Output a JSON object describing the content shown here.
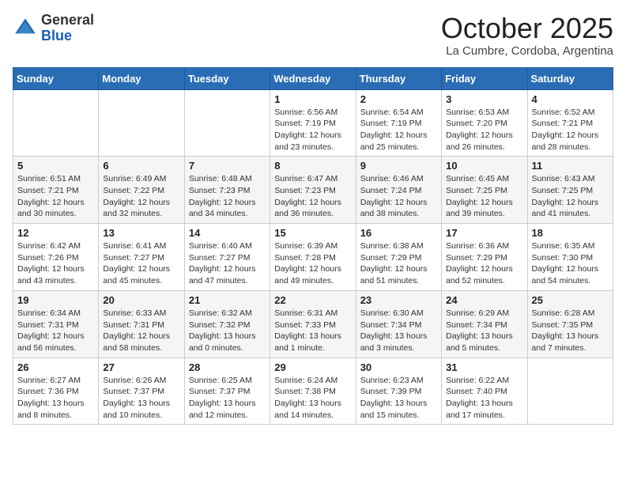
{
  "header": {
    "logo_general": "General",
    "logo_blue": "Blue",
    "month": "October 2025",
    "location": "La Cumbre, Cordoba, Argentina"
  },
  "days_of_week": [
    "Sunday",
    "Monday",
    "Tuesday",
    "Wednesday",
    "Thursday",
    "Friday",
    "Saturday"
  ],
  "weeks": [
    [
      {
        "date": "",
        "sunrise": "",
        "sunset": "",
        "daylight": ""
      },
      {
        "date": "",
        "sunrise": "",
        "sunset": "",
        "daylight": ""
      },
      {
        "date": "",
        "sunrise": "",
        "sunset": "",
        "daylight": ""
      },
      {
        "date": "1",
        "sunrise": "Sunrise: 6:56 AM",
        "sunset": "Sunset: 7:19 PM",
        "daylight": "Daylight: 12 hours and 23 minutes."
      },
      {
        "date": "2",
        "sunrise": "Sunrise: 6:54 AM",
        "sunset": "Sunset: 7:19 PM",
        "daylight": "Daylight: 12 hours and 25 minutes."
      },
      {
        "date": "3",
        "sunrise": "Sunrise: 6:53 AM",
        "sunset": "Sunset: 7:20 PM",
        "daylight": "Daylight: 12 hours and 26 minutes."
      },
      {
        "date": "4",
        "sunrise": "Sunrise: 6:52 AM",
        "sunset": "Sunset: 7:21 PM",
        "daylight": "Daylight: 12 hours and 28 minutes."
      }
    ],
    [
      {
        "date": "5",
        "sunrise": "Sunrise: 6:51 AM",
        "sunset": "Sunset: 7:21 PM",
        "daylight": "Daylight: 12 hours and 30 minutes."
      },
      {
        "date": "6",
        "sunrise": "Sunrise: 6:49 AM",
        "sunset": "Sunset: 7:22 PM",
        "daylight": "Daylight: 12 hours and 32 minutes."
      },
      {
        "date": "7",
        "sunrise": "Sunrise: 6:48 AM",
        "sunset": "Sunset: 7:23 PM",
        "daylight": "Daylight: 12 hours and 34 minutes."
      },
      {
        "date": "8",
        "sunrise": "Sunrise: 6:47 AM",
        "sunset": "Sunset: 7:23 PM",
        "daylight": "Daylight: 12 hours and 36 minutes."
      },
      {
        "date": "9",
        "sunrise": "Sunrise: 6:46 AM",
        "sunset": "Sunset: 7:24 PM",
        "daylight": "Daylight: 12 hours and 38 minutes."
      },
      {
        "date": "10",
        "sunrise": "Sunrise: 6:45 AM",
        "sunset": "Sunset: 7:25 PM",
        "daylight": "Daylight: 12 hours and 39 minutes."
      },
      {
        "date": "11",
        "sunrise": "Sunrise: 6:43 AM",
        "sunset": "Sunset: 7:25 PM",
        "daylight": "Daylight: 12 hours and 41 minutes."
      }
    ],
    [
      {
        "date": "12",
        "sunrise": "Sunrise: 6:42 AM",
        "sunset": "Sunset: 7:26 PM",
        "daylight": "Daylight: 12 hours and 43 minutes."
      },
      {
        "date": "13",
        "sunrise": "Sunrise: 6:41 AM",
        "sunset": "Sunset: 7:27 PM",
        "daylight": "Daylight: 12 hours and 45 minutes."
      },
      {
        "date": "14",
        "sunrise": "Sunrise: 6:40 AM",
        "sunset": "Sunset: 7:27 PM",
        "daylight": "Daylight: 12 hours and 47 minutes."
      },
      {
        "date": "15",
        "sunrise": "Sunrise: 6:39 AM",
        "sunset": "Sunset: 7:28 PM",
        "daylight": "Daylight: 12 hours and 49 minutes."
      },
      {
        "date": "16",
        "sunrise": "Sunrise: 6:38 AM",
        "sunset": "Sunset: 7:29 PM",
        "daylight": "Daylight: 12 hours and 51 minutes."
      },
      {
        "date": "17",
        "sunrise": "Sunrise: 6:36 AM",
        "sunset": "Sunset: 7:29 PM",
        "daylight": "Daylight: 12 hours and 52 minutes."
      },
      {
        "date": "18",
        "sunrise": "Sunrise: 6:35 AM",
        "sunset": "Sunset: 7:30 PM",
        "daylight": "Daylight: 12 hours and 54 minutes."
      }
    ],
    [
      {
        "date": "19",
        "sunrise": "Sunrise: 6:34 AM",
        "sunset": "Sunset: 7:31 PM",
        "daylight": "Daylight: 12 hours and 56 minutes."
      },
      {
        "date": "20",
        "sunrise": "Sunrise: 6:33 AM",
        "sunset": "Sunset: 7:31 PM",
        "daylight": "Daylight: 12 hours and 58 minutes."
      },
      {
        "date": "21",
        "sunrise": "Sunrise: 6:32 AM",
        "sunset": "Sunset: 7:32 PM",
        "daylight": "Daylight: 13 hours and 0 minutes."
      },
      {
        "date": "22",
        "sunrise": "Sunrise: 6:31 AM",
        "sunset": "Sunset: 7:33 PM",
        "daylight": "Daylight: 13 hours and 1 minute."
      },
      {
        "date": "23",
        "sunrise": "Sunrise: 6:30 AM",
        "sunset": "Sunset: 7:34 PM",
        "daylight": "Daylight: 13 hours and 3 minutes."
      },
      {
        "date": "24",
        "sunrise": "Sunrise: 6:29 AM",
        "sunset": "Sunset: 7:34 PM",
        "daylight": "Daylight: 13 hours and 5 minutes."
      },
      {
        "date": "25",
        "sunrise": "Sunrise: 6:28 AM",
        "sunset": "Sunset: 7:35 PM",
        "daylight": "Daylight: 13 hours and 7 minutes."
      }
    ],
    [
      {
        "date": "26",
        "sunrise": "Sunrise: 6:27 AM",
        "sunset": "Sunset: 7:36 PM",
        "daylight": "Daylight: 13 hours and 8 minutes."
      },
      {
        "date": "27",
        "sunrise": "Sunrise: 6:26 AM",
        "sunset": "Sunset: 7:37 PM",
        "daylight": "Daylight: 13 hours and 10 minutes."
      },
      {
        "date": "28",
        "sunrise": "Sunrise: 6:25 AM",
        "sunset": "Sunset: 7:37 PM",
        "daylight": "Daylight: 13 hours and 12 minutes."
      },
      {
        "date": "29",
        "sunrise": "Sunrise: 6:24 AM",
        "sunset": "Sunset: 7:38 PM",
        "daylight": "Daylight: 13 hours and 14 minutes."
      },
      {
        "date": "30",
        "sunrise": "Sunrise: 6:23 AM",
        "sunset": "Sunset: 7:39 PM",
        "daylight": "Daylight: 13 hours and 15 minutes."
      },
      {
        "date": "31",
        "sunrise": "Sunrise: 6:22 AM",
        "sunset": "Sunset: 7:40 PM",
        "daylight": "Daylight: 13 hours and 17 minutes."
      },
      {
        "date": "",
        "sunrise": "",
        "sunset": "",
        "daylight": ""
      }
    ]
  ]
}
